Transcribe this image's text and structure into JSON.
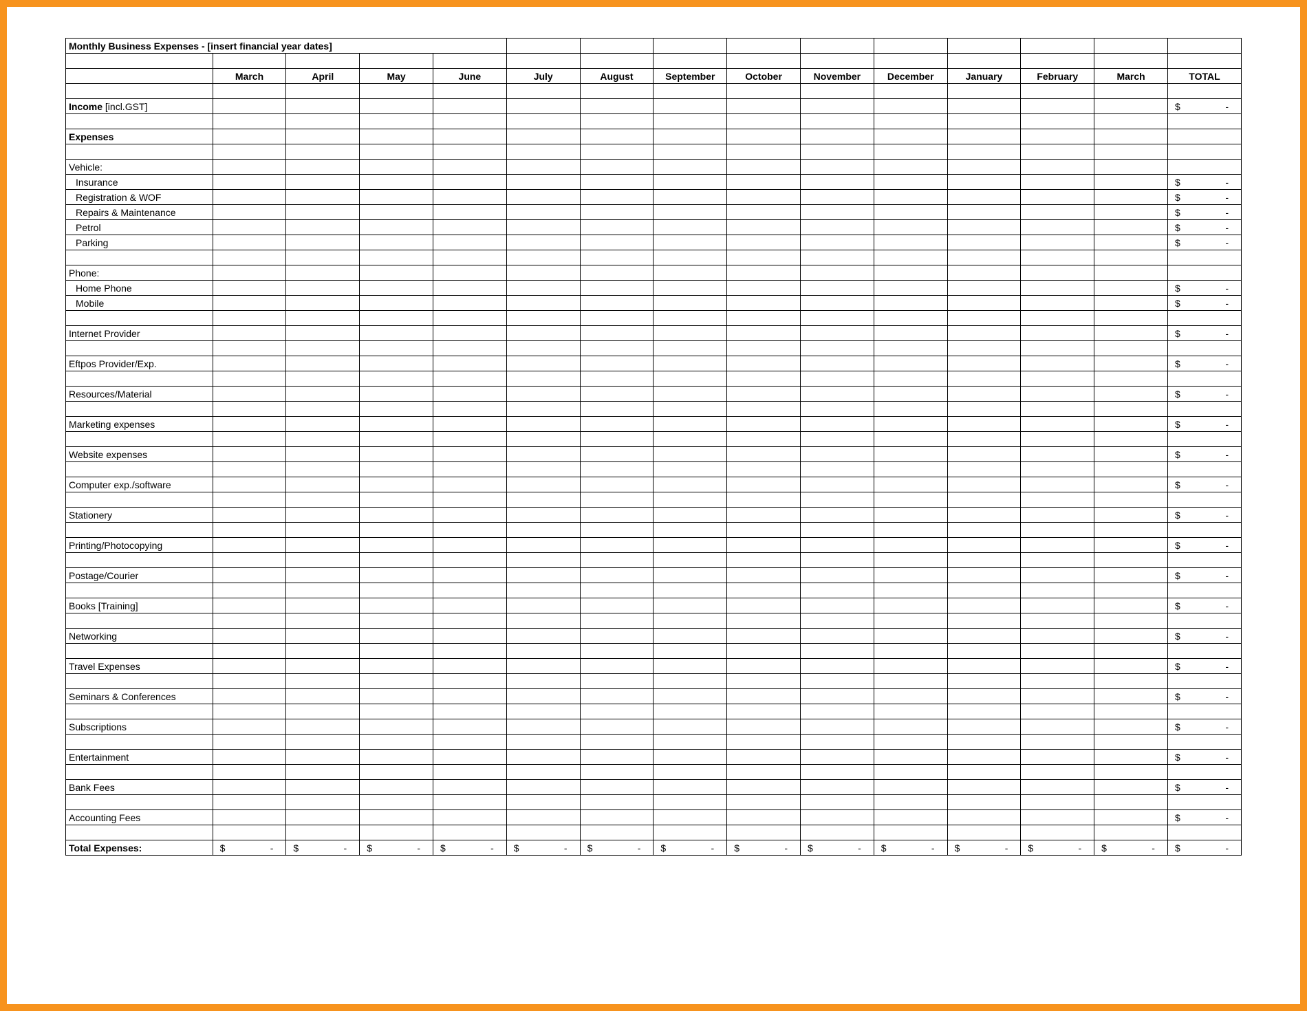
{
  "title": "Monthly Business Expenses - [insert financial year dates]",
  "months": [
    "March",
    "April",
    "May",
    "June",
    "July",
    "August",
    "September",
    "October",
    "November",
    "December",
    "January",
    "February",
    "March"
  ],
  "total_header": "TOTAL",
  "income_label_bold": "Income",
  "income_label_rest": " [incl.GST]",
  "expenses_header": "Expenses",
  "section_vehicle": "Vehicle:",
  "vehicle_items": [
    "Insurance",
    "Registration & WOF",
    "Repairs & Maintenance",
    "Petrol",
    "Parking"
  ],
  "section_phone": "Phone:",
  "phone_items": [
    "Home Phone",
    "Mobile"
  ],
  "single_items": [
    "Internet Provider",
    "Eftpos Provider/Exp.",
    "Resources/Material",
    "Marketing expenses",
    "Website expenses",
    "Computer exp./software",
    "Stationery",
    "Printing/Photocopying",
    "Postage/Courier",
    "Books [Training]",
    "Networking",
    "Travel Expenses",
    "Seminars & Conferences",
    "Subscriptions",
    "Entertainment",
    "Bank Fees",
    "Accounting Fees"
  ],
  "total_expenses_label": "Total Expenses:",
  "currency_symbol": "$",
  "dash": "-"
}
